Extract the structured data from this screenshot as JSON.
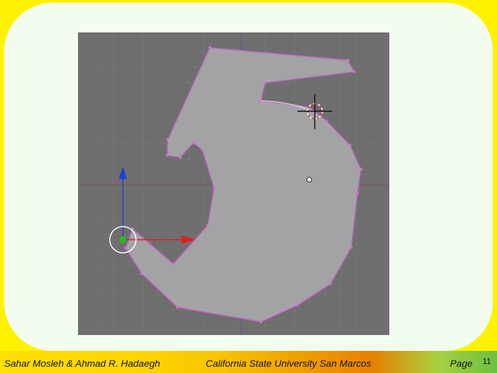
{
  "footer": {
    "authors": "Sahar Mosleh & Ahmad R. Hadaegh",
    "institution": "California State University San Marcos",
    "page_label": "Page",
    "page_number": "11"
  },
  "viewport": {
    "background": "#6e6e6e",
    "grid_color": "#7a7a7a",
    "mesh_fill": "#a3a3a6",
    "edge_color": "#c060c0",
    "x_axis_color": "#e02020",
    "y_axis_color": "#2040d0",
    "object_center_color": "#20c020",
    "icons": [
      "3d-cursor-icon",
      "object-origin-icon",
      "translate-x-arrow-icon",
      "translate-y-arrow-icon"
    ]
  }
}
